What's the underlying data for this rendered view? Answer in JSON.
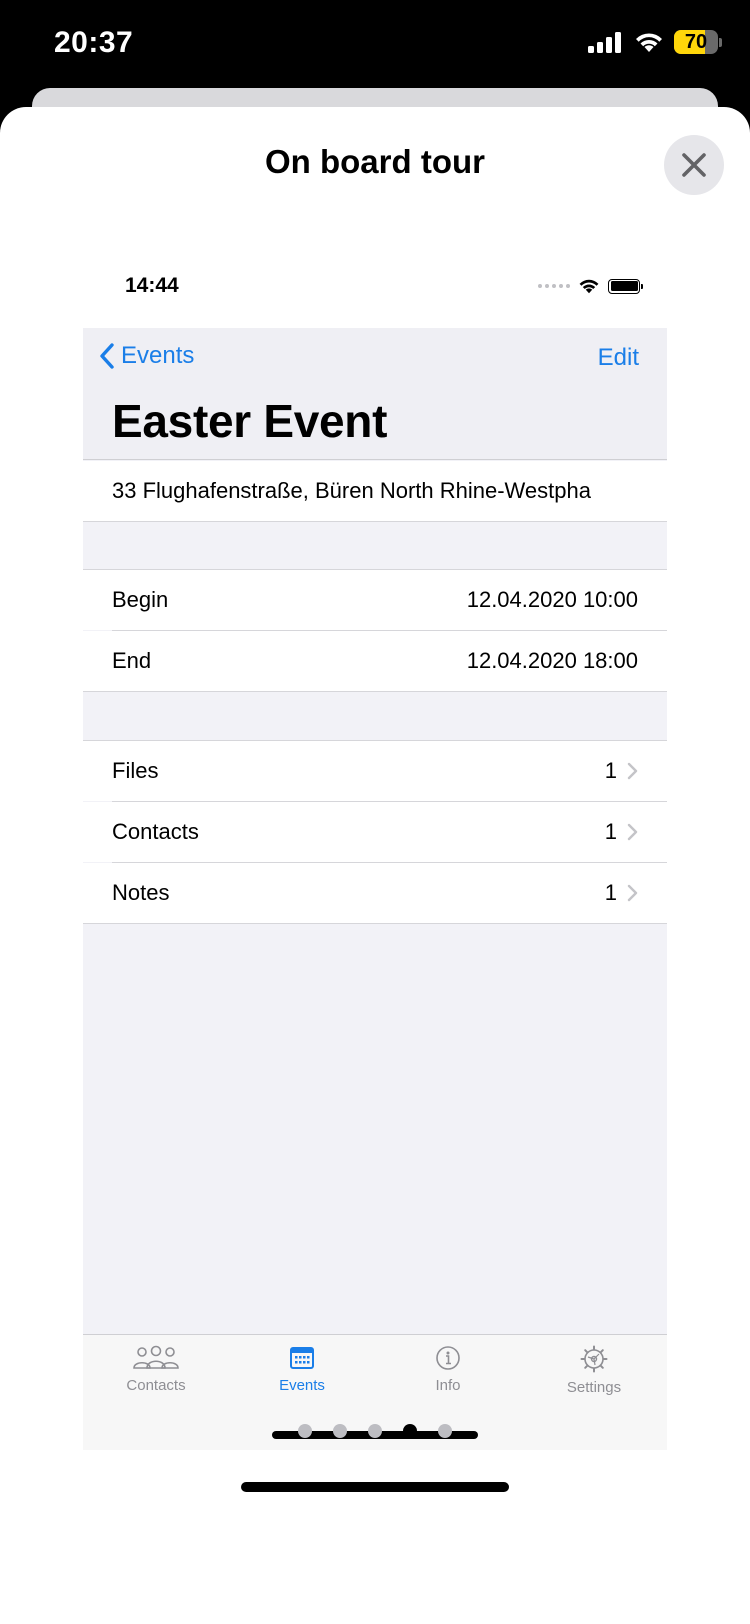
{
  "status_bar": {
    "time": "20:37",
    "battery": "70",
    "battery_level": 0.7
  },
  "sheet": {
    "title": "On board tour"
  },
  "mock": {
    "status": {
      "time": "14:44"
    },
    "nav": {
      "back_label": "Events",
      "edit_label": "Edit",
      "title": "Easter Event"
    },
    "address": "33 Flughafenstraße, Büren North Rhine-Westpha",
    "dates": [
      {
        "label": "Begin",
        "value": "12.04.2020 10:00"
      },
      {
        "label": "End",
        "value": "12.04.2020 18:00"
      }
    ],
    "links": [
      {
        "label": "Files",
        "count": "1"
      },
      {
        "label": "Contacts",
        "count": "1"
      },
      {
        "label": "Notes",
        "count": "1"
      }
    ],
    "tabs": [
      {
        "label": "Contacts",
        "icon": "people-icon"
      },
      {
        "label": "Events",
        "icon": "calendar-icon",
        "active": true
      },
      {
        "label": "Info",
        "icon": "info-icon"
      },
      {
        "label": "Settings",
        "icon": "gear-icon"
      }
    ]
  },
  "pager": {
    "pages": 5,
    "current": 4
  },
  "colors": {
    "accent": "#1a7ee8",
    "battery": "#ffd60a"
  }
}
